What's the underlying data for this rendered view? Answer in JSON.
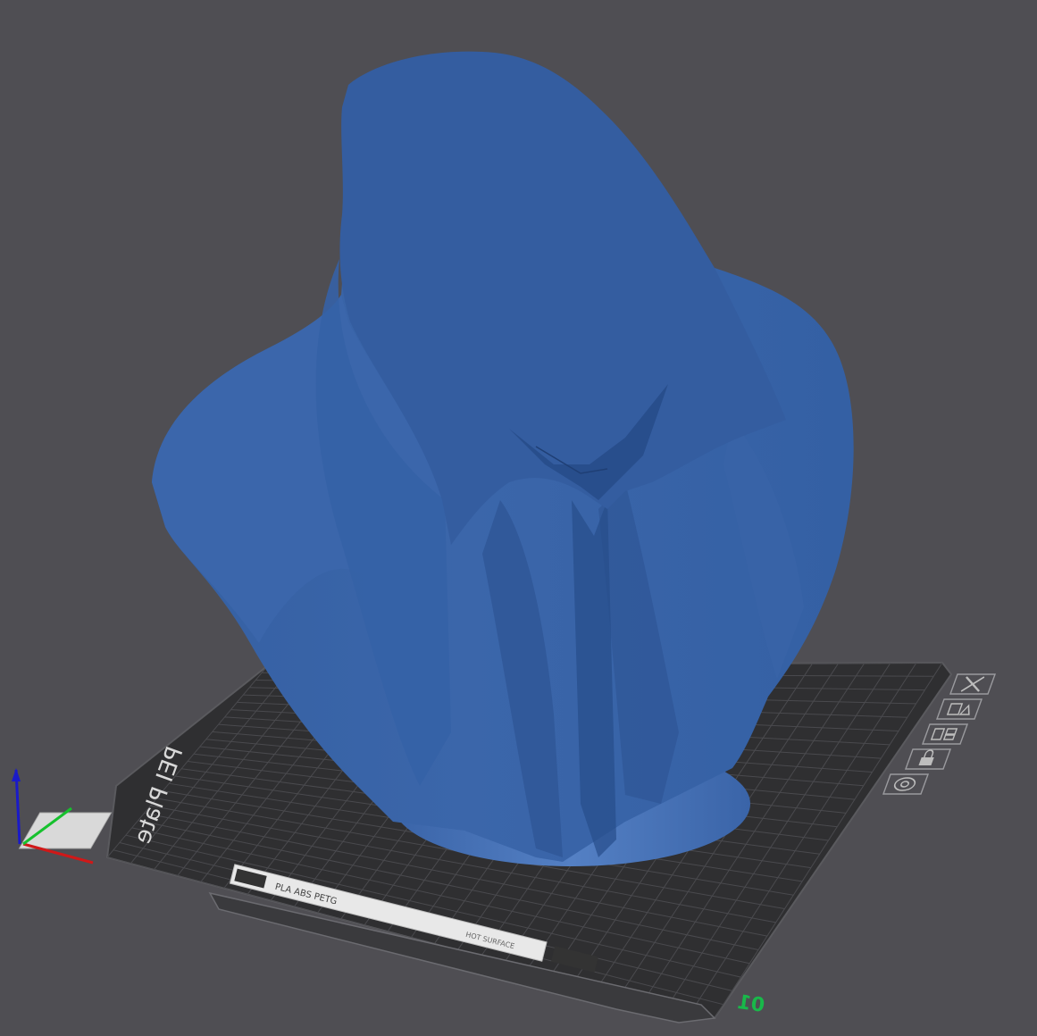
{
  "viewport": {
    "background": "#4f4e53",
    "plate_label": "PEI Plate",
    "plate_number": "01",
    "sticker_material": "PLA ABS PETG",
    "sticker_warning": "HOT SURFACE"
  },
  "plate_toolbar": {
    "items": [
      {
        "icon": "close-icon"
      },
      {
        "icon": "fit-image-icon"
      },
      {
        "icon": "arrange-icon"
      },
      {
        "icon": "lock-icon"
      },
      {
        "icon": "settings-icon"
      }
    ]
  },
  "colors": {
    "model": "#3d65a6",
    "model_dark": "#2f528c",
    "model_light": "#4a75b8",
    "plate": "#2f2f31",
    "grid": "#4a4a4e",
    "axis_x": "#d01818",
    "axis_y": "#17c12e",
    "axis_z": "#1a1ac8",
    "plate_number": "#19b84a"
  }
}
